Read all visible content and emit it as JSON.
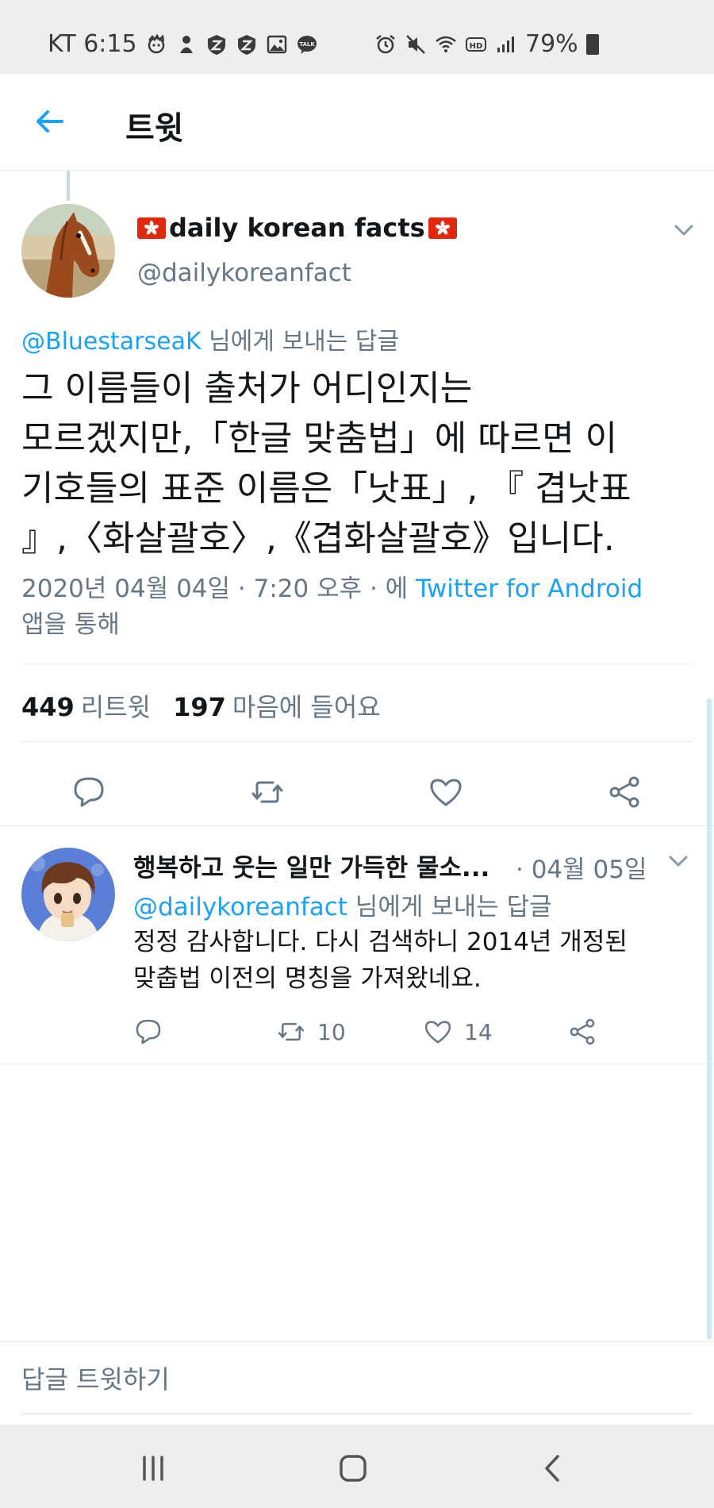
{
  "status_bar": {
    "carrier_time": "KT 6:15",
    "battery": "79%",
    "left_icons": [
      "anime-app-icon",
      "game-app-icon",
      "shield-app-icon",
      "shield-app-icon-2",
      "gallery-icon",
      "kakaotalk-icon"
    ],
    "right_icons": [
      "alarm-icon",
      "mute-icon",
      "wifi-icon",
      "hd-icon",
      "signal-icon"
    ]
  },
  "header": {
    "title": "트윗"
  },
  "main_tweet": {
    "display_name": "daily korean facts",
    "username": "@dailykoreanfact",
    "reply_prefix": "@BluestarseaK",
    "reply_suffix": " 님에게 보내는 답글",
    "text_lines": [
      "그 이름들이 출처가 어디인지는",
      "모르겠지만,「한글 맞춤법」에 따르면 이",
      "기호들의 표준 이름은「낫표」, 『 겹낫표",
      "』,〈화살괄호〉,《겹화살괄호》입니다."
    ],
    "meta_date": "2020년 04월 04일 · 7:20 오후 · 에 ",
    "meta_app": "Twitter for Android",
    "meta_suffix": "앱을 통해",
    "retweet_count": "449",
    "retweet_label": "리트윗",
    "like_count": "197",
    "like_label": "마음에 들어요"
  },
  "reply_tweet": {
    "display_name": "행복하고 웃는 일만 가득한 물소...",
    "date": "· 04월 05일",
    "reply_prefix": "@dailykoreanfact",
    "reply_suffix": " 님에게 보내는 답글",
    "text_lines": [
      "정정 감사합니다. 다시 검색하니 2014년 개정된",
      "맞춥법 이전의 명칭을 가져왔네요."
    ],
    "retweet_count": "10",
    "like_count": "14"
  },
  "compose": {
    "placeholder": "답글 트윗하기"
  },
  "colors": {
    "accent": "#1da1f2",
    "secondary_text": "#657786",
    "primary_text": "#14171a",
    "status_bar_bg": "#eeeeee"
  }
}
